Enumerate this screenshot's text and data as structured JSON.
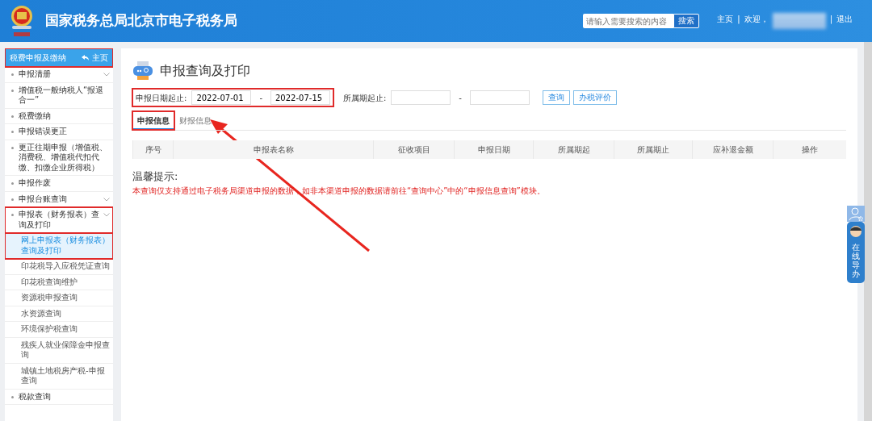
{
  "header": {
    "title": "国家税务总局北京市电子税务局",
    "search": {
      "placeholder": "请输入需要搜索的内容",
      "button": "搜索"
    },
    "links": [
      {
        "kind": "link",
        "text": "主页"
      },
      {
        "kind": "sep",
        "text": "|"
      },
      {
        "kind": "text",
        "text": "欢迎，"
      },
      {
        "kind": "redacted"
      },
      {
        "kind": "sep",
        "text": "|"
      },
      {
        "kind": "link",
        "text": "退出"
      }
    ]
  },
  "sidebar": {
    "title": "税费申报及缴纳",
    "home": "主页",
    "highlighted": true,
    "items": [
      {
        "label": "申报清册",
        "expandable": true,
        "highlighted": false
      },
      {
        "label": "增值税一般纳税人“报退合一”",
        "expandable": false,
        "highlighted": false
      },
      {
        "label": "税费缴纳",
        "expandable": false,
        "highlighted": false
      },
      {
        "label": "申报错误更正",
        "expandable": false,
        "highlighted": false
      },
      {
        "label": "更正往期申报（增值税、消费税、增值税代扣代缴、扣缴企业所得税）",
        "expandable": false,
        "highlighted": false
      },
      {
        "label": "申报作废",
        "expandable": false,
        "highlighted": false
      },
      {
        "label": "申报台账查询",
        "expandable": true,
        "highlighted": false
      },
      {
        "label": "申报表（财务报表）查询及打印",
        "expandable": true,
        "highlighted": true,
        "children": [
          {
            "label": "网上申报表（财务报表）查询及打印",
            "selected": true,
            "highlighted": true
          },
          {
            "label": "印花税导入应税凭证查询",
            "selected": false,
            "highlighted": false
          },
          {
            "label": "印花税查询维护",
            "selected": false,
            "highlighted": false
          },
          {
            "label": "资源税申报查询",
            "selected": false,
            "highlighted": false
          },
          {
            "label": "水资源查询",
            "selected": false,
            "highlighted": false
          },
          {
            "label": "环境保护税查询",
            "selected": false,
            "highlighted": false
          },
          {
            "label": "残疾人就业保障金申报查询",
            "selected": false,
            "highlighted": false
          },
          {
            "label": "城镇土地税房产税-申报查询",
            "selected": false,
            "highlighted": false
          }
        ]
      },
      {
        "label": "税款查询",
        "expandable": false,
        "highlighted": false
      }
    ]
  },
  "main": {
    "title": "申报查询及打印",
    "filters": [
      {
        "label": "申报日期起止:",
        "from": "2022-07-01",
        "sep": "-",
        "to": "2022-07-15",
        "highlighted": true
      },
      {
        "label": "所属期起止:",
        "sep": "-",
        "highlighted": false
      }
    ],
    "buttons": [
      "查询",
      "办税评价"
    ],
    "tabs": [
      {
        "label": "申报信息",
        "selected": true,
        "highlighted": true
      },
      {
        "label": "财报信息",
        "selected": false,
        "highlighted": false
      }
    ],
    "table": {
      "columns": [
        "序号",
        "申报表名称",
        "征收项目",
        "申报日期",
        "所属期起",
        "所属期止",
        "应补退金额",
        "操作"
      ]
    },
    "tip_title": "温馨提示:",
    "tip_text": "本查询仅支持通过电子税务局渠道申报的数据，如非本渠道申报的数据请前往“查询中心”中的“申报信息查询”模块。"
  },
  "helper": {
    "label": "在线导办"
  },
  "annotations": {
    "arrow": true
  }
}
